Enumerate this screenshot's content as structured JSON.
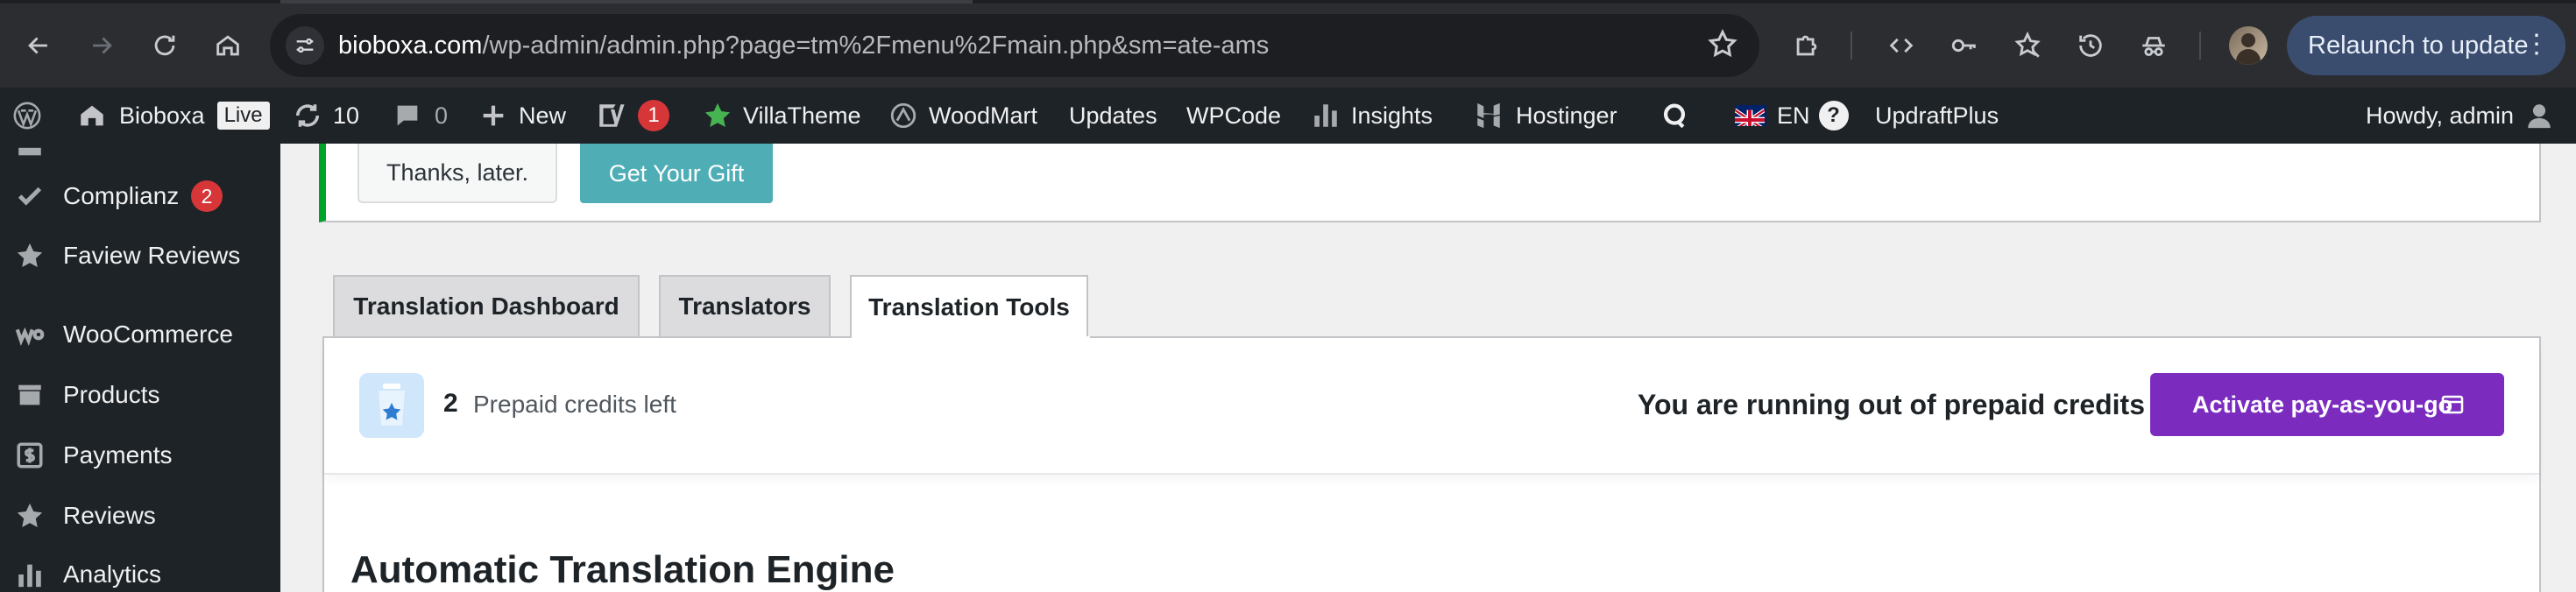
{
  "browser": {
    "url_domain": "bioboxa.com",
    "url_path": "/wp-admin/admin.php?page=tm%2Fmenu%2Fmain.php&sm=ate-ams",
    "relaunch_label": "Relaunch to update",
    "icons": [
      "back-icon",
      "forward-icon",
      "reload-icon",
      "home-icon",
      "site-info-icon",
      "star-icon",
      "extensions-icon",
      "code-icon",
      "password-icon",
      "bookmark-star-icon",
      "history-icon",
      "incognito-icon"
    ]
  },
  "adminbar": {
    "site_name": "Bioboxa",
    "live_badge": "Live",
    "updates_count": "10",
    "comments_count": "0",
    "new_label": "New",
    "yoast_count": "1",
    "villatheme": "VillaTheme",
    "woodmart": "WoodMart",
    "updates": "Updates",
    "wpcode": "WPCode",
    "insights": "Insights",
    "hostinger": "Hostinger",
    "language": "EN",
    "updraftplus": "UpdraftPlus",
    "howdy": "Howdy, admin"
  },
  "sidebar": {
    "items": [
      {
        "label": "Complianz",
        "badge": "2",
        "icon": "check-icon"
      },
      {
        "label": "Faview Reviews",
        "icon": "star-icon"
      },
      {
        "label": "WooCommerce",
        "icon": "woocommerce-icon"
      },
      {
        "label": "Products",
        "icon": "archive-icon"
      },
      {
        "label": "Payments",
        "icon": "dollar-icon"
      },
      {
        "label": "Reviews",
        "icon": "star-icon"
      },
      {
        "label": "Analytics",
        "icon": "bar-chart-icon"
      }
    ]
  },
  "notice": {
    "later_label": "Thanks, later.",
    "gift_label": "Get Your Gift"
  },
  "tabs": [
    {
      "label": "Translation Dashboard",
      "active": false
    },
    {
      "label": "Translators",
      "active": false
    },
    {
      "label": "Translation Tools",
      "active": true
    }
  ],
  "credits": {
    "count": "2",
    "label": "Prepaid credits left",
    "warning": "You are running out of prepaid credits",
    "activate_label": "Activate pay-as-you-go"
  },
  "section": {
    "heading": "Automatic Translation Engine"
  },
  "colors": {
    "adminbar_bg": "#1d2327",
    "accent_purple": "#7b2cbf",
    "gift_teal": "#4fadb6",
    "notice_green": "#00a32a",
    "badge_red": "#d63638"
  }
}
